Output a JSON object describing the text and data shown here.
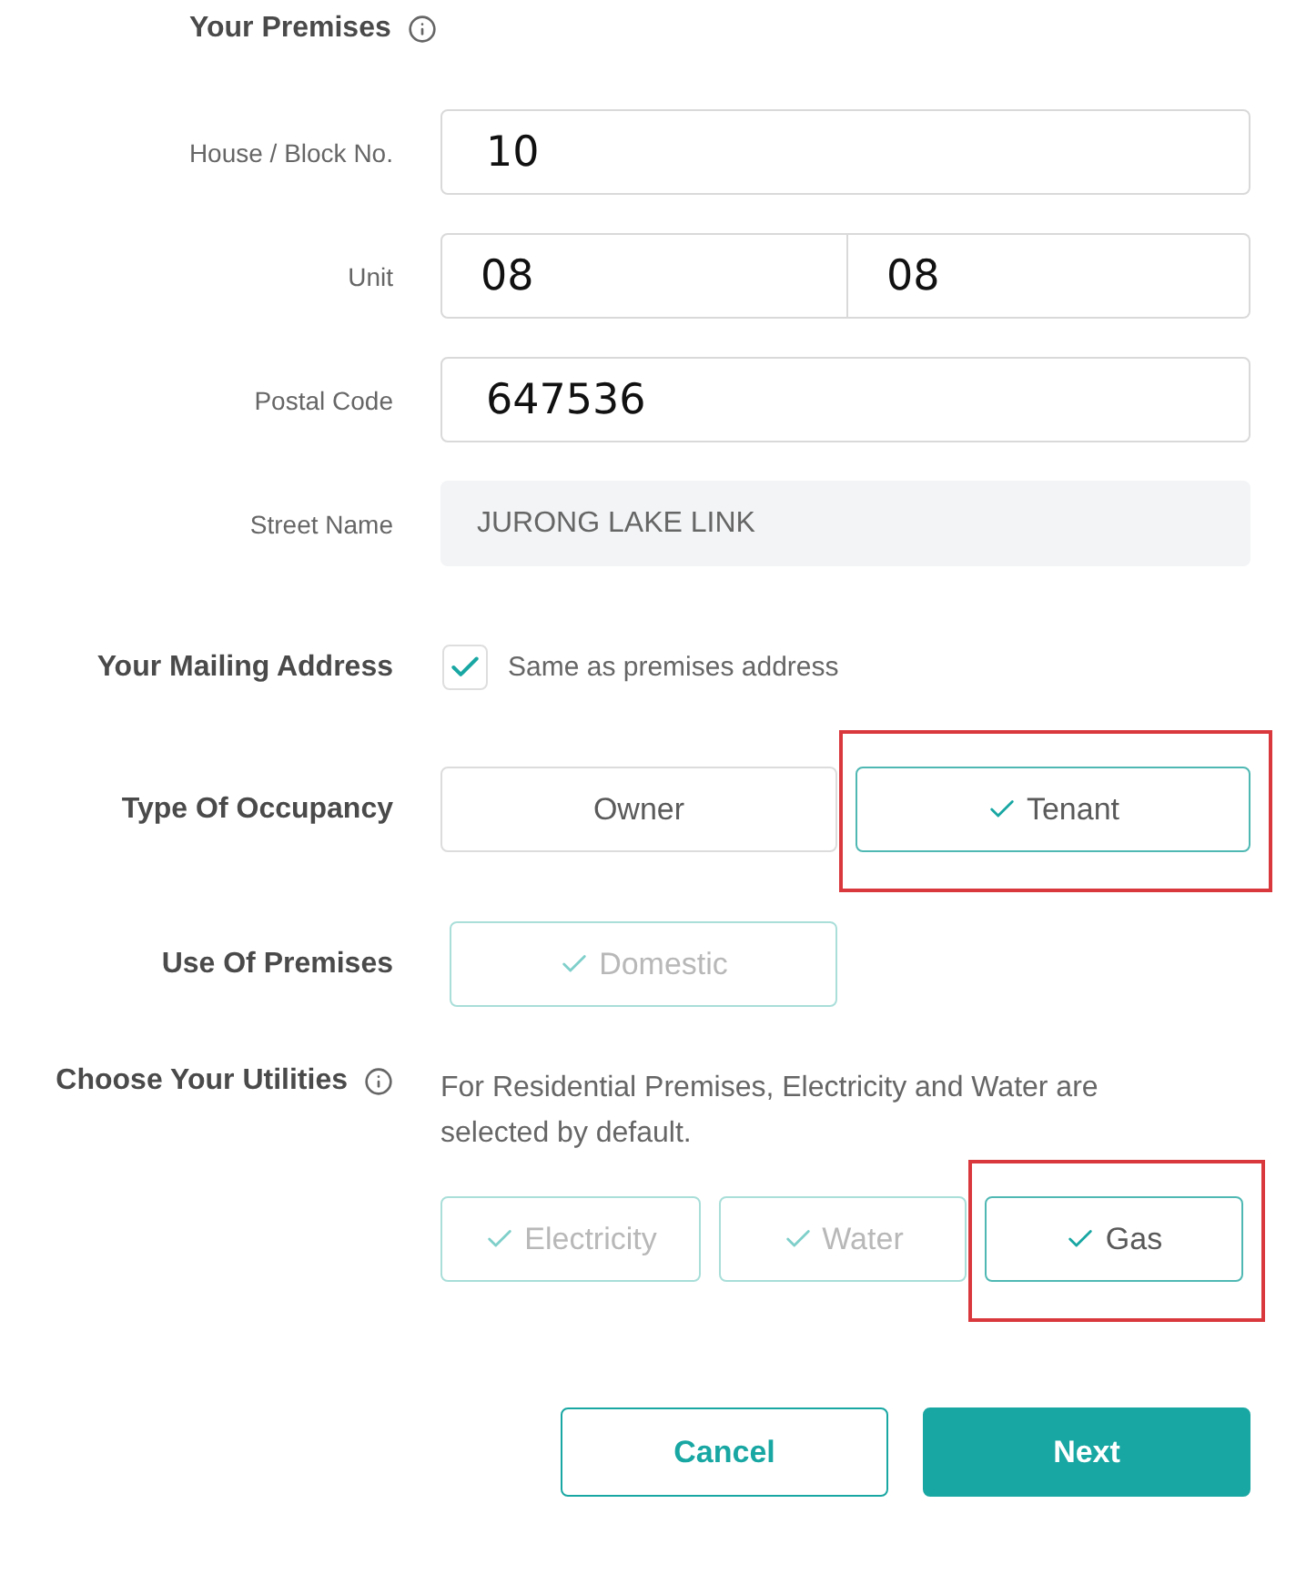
{
  "premises": {
    "title": "Your Premises",
    "fields": [
      {
        "label": "House / Block No.",
        "kind": "input",
        "values": [
          "10"
        ]
      },
      {
        "label": "Unit",
        "kind": "split",
        "values": [
          "08",
          "08"
        ]
      },
      {
        "label": "Postal Code",
        "kind": "input",
        "values": [
          "647536"
        ]
      },
      {
        "label": "Street Name",
        "kind": "readonly",
        "values": [
          "JURONG LAKE LINK"
        ]
      }
    ]
  },
  "mailing_address": {
    "label": "Your Mailing Address",
    "checkbox": {
      "label": "Same as premises address",
      "checked": true
    }
  },
  "occupancy": {
    "label": "Type Of Occupancy",
    "options": [
      {
        "label": "Owner",
        "selected": false,
        "disabled": false,
        "highlighted": false
      },
      {
        "label": "Tenant",
        "selected": true,
        "disabled": false,
        "highlighted": true
      }
    ]
  },
  "use_of_premises": {
    "label": "Use Of Premises",
    "options": [
      {
        "label": "Domestic",
        "selected": true,
        "disabled": true,
        "highlighted": false
      }
    ]
  },
  "utilities": {
    "label": "Choose Your Utilities",
    "note": "For Residential Premises, Electricity and Water are selected by default.",
    "options": [
      {
        "label": "Electricity",
        "selected": true,
        "disabled": true,
        "highlighted": false
      },
      {
        "label": "Water",
        "selected": true,
        "disabled": true,
        "highlighted": false
      },
      {
        "label": "Gas",
        "selected": true,
        "disabled": false,
        "highlighted": true
      }
    ]
  },
  "actions": [
    {
      "label": "Cancel",
      "kind": "secondary"
    },
    {
      "label": "Next",
      "kind": "primary"
    }
  ]
}
